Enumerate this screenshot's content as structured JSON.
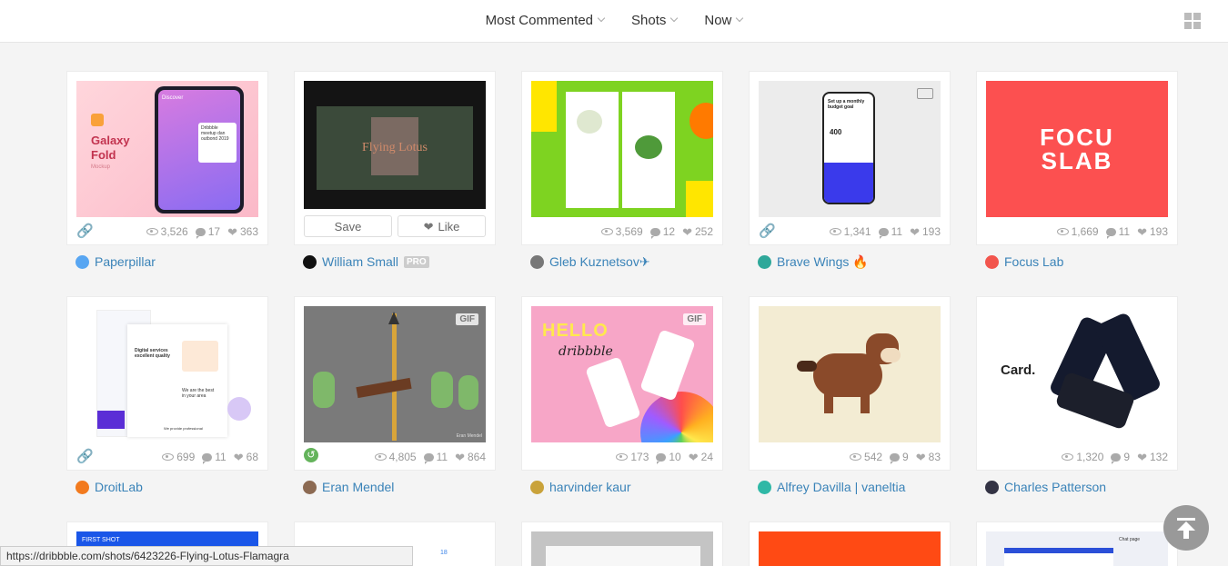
{
  "filters": [
    {
      "label": "Most Commented"
    },
    {
      "label": "Shots"
    },
    {
      "label": "Now"
    }
  ],
  "buttons": {
    "save": "Save",
    "like": "Like"
  },
  "shots": [
    {
      "views": "3,526",
      "comments": "17",
      "likes": "363",
      "author": "Paperpillar",
      "art": {
        "title": "Galaxy Fold",
        "subtitle": "Mockup",
        "app_title": "Discover",
        "event": "Dribbble meetup dan outbond 2019"
      }
    },
    {
      "author": "William Small",
      "badge": "PRO",
      "art": {
        "title": "Flying Lotus"
      }
    },
    {
      "views": "3,569",
      "comments": "12",
      "likes": "252",
      "author": "Gleb Kuznetsov✈"
    },
    {
      "views": "1,341",
      "comments": "11",
      "likes": "193",
      "author": "Brave Wings 🔥",
      "art": {
        "heading": "Set up a monthly budget goal",
        "amount": "400"
      }
    },
    {
      "views": "1,669",
      "comments": "11",
      "likes": "193",
      "author": "Focus Lab",
      "art": {
        "line1": "FOCU",
        "line2": "SLAB"
      }
    },
    {
      "views": "699",
      "comments": "11",
      "likes": "68",
      "author": "DroitLab",
      "art": {
        "headline": "Digital services excellent quality",
        "best": "We are the best in your area",
        "footer": "We provide professional"
      }
    },
    {
      "views": "4,805",
      "comments": "11",
      "likes": "864",
      "author": "Eran Mendel",
      "badge": "GIF",
      "art": {
        "signature": "Eran Mendel"
      }
    },
    {
      "views": "173",
      "comments": "10",
      "likes": "24",
      "author": "harvinder kaur",
      "badge": "GIF",
      "art": {
        "hello": "HELLO",
        "dribbble": "dribbble"
      }
    },
    {
      "views": "542",
      "comments": "9",
      "likes": "83",
      "author": "Alfrey Davilla | vaneltia"
    },
    {
      "views": "1,320",
      "comments": "9",
      "likes": "132",
      "author": "Charles Patterson",
      "art": {
        "title": "Card."
      }
    }
  ],
  "partial_shots": [
    {
      "label": "FIRST SHOT"
    },
    {
      "label": "18"
    },
    {
      "label": ""
    },
    {
      "label": ""
    },
    {
      "label": "Chat page"
    }
  ],
  "status_url": "https://dribbble.com/shots/6423226-Flying-Lotus-Flamagra",
  "colors": {
    "link": "#3a83b8",
    "background": "#f4f4f4"
  }
}
